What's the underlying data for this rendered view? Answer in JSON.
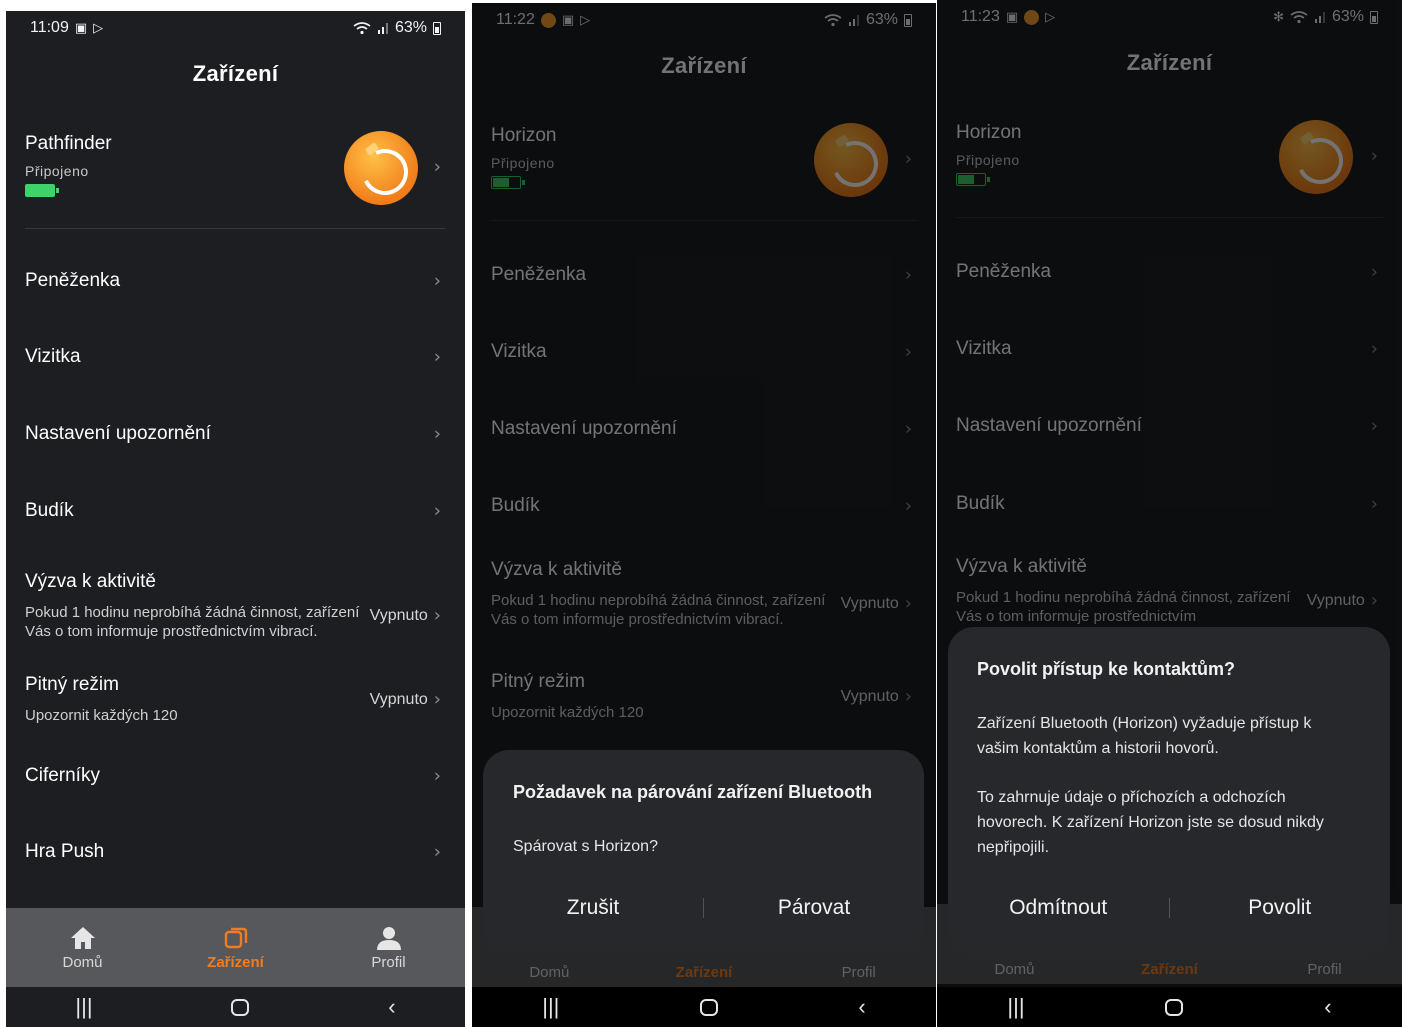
{
  "screen1": {
    "status": {
      "time": "11:09",
      "battery": "63%"
    },
    "title": "Zařízení",
    "device": {
      "name": "Pathfinder",
      "status": "Připojeno"
    },
    "menu": [
      "Peněženka",
      "Vizitka",
      "Nastavení upozornění",
      "Budík"
    ],
    "activity": {
      "title": "Výzva k aktivitě",
      "desc": "Pokud 1 hodinu neprobíhá žádná činnost, zařízení Vás o tom informuje prostřednictvím vibrací.",
      "value": "Vypnuto"
    },
    "drink": {
      "title": "Pitný režim",
      "desc": "Upozornit každých 120",
      "value": "Vypnuto"
    },
    "menu2": [
      "Ciferníky",
      "Hra Push"
    ],
    "nav": {
      "home": "Domů",
      "device": "Zařízení",
      "profile": "Profil"
    }
  },
  "screen2": {
    "status": {
      "time": "11:22",
      "battery": "63%"
    },
    "title": "Zařízení",
    "device": {
      "name": "Horizon",
      "status": "Připojeno"
    },
    "menu": [
      "Peněženka",
      "Vizitka",
      "Nastavení upozornění",
      "Budík"
    ],
    "activity": {
      "title": "Výzva k aktivitě",
      "desc": "Pokud 1 hodinu neprobíhá žádná činnost, zařízení Vás o tom informuje prostřednictvím vibrací.",
      "value": "Vypnuto"
    },
    "drink": {
      "title": "Pitný režim",
      "desc": "Upozornit každých 120",
      "value": "Vypnuto"
    },
    "nav": {
      "home": "Domů",
      "device": "Zařízení",
      "profile": "Profil"
    },
    "dialog": {
      "title": "Požadavek na párování zařízení Bluetooth",
      "body": "Spárovat s Horizon?",
      "cancel": "Zrušit",
      "confirm": "Párovat"
    }
  },
  "screen3": {
    "status": {
      "time": "11:23",
      "battery": "63%"
    },
    "title": "Zařízení",
    "device": {
      "name": "Horizon",
      "status": "Připojeno"
    },
    "menu": [
      "Peněženka",
      "Vizitka",
      "Nastavení upozornění",
      "Budík"
    ],
    "activity": {
      "title": "Výzva k aktivitě",
      "desc": "Pokud 1 hodinu neprobíhá žádná činnost, zařízení Vás o tom informuje prostřednictvím",
      "value": "Vypnuto"
    },
    "nav": {
      "home": "Domů",
      "device": "Zařízení",
      "profile": "Profil"
    },
    "dialog": {
      "title": "Povolit přístup ke kontaktům?",
      "body1": "Zařízení Bluetooth (Horizon) vyžaduje přístup k vašim kontaktům a historii hovorů.",
      "body2": "To zahrnuje údaje o příchozích a odchozích hovorech. K zařízení Horizon jste se dosud nikdy nepřipojili.",
      "deny": "Odmítnout",
      "allow": "Povolit"
    }
  },
  "colors": {
    "background": "#1c1e22",
    "accent": "#f37c1e",
    "battery": "#3dd26a",
    "nav_bg": "#56585c"
  }
}
